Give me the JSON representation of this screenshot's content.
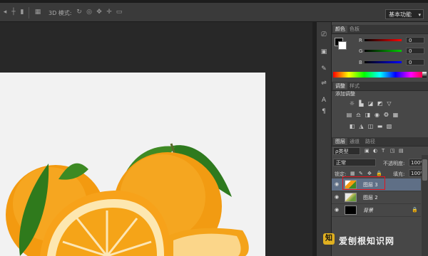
{
  "options_bar": {
    "mode_label": "3D 模式:",
    "workspace": "基本功能"
  },
  "color_panel": {
    "tabs": [
      "颜色",
      "色板"
    ],
    "channels": [
      {
        "label": "R",
        "value": "0",
        "color": "#d02020"
      },
      {
        "label": "G",
        "value": "0",
        "color": "#20a020"
      },
      {
        "label": "B",
        "value": "0",
        "color": "#2030d0"
      }
    ]
  },
  "adjust_panel": {
    "tabs": [
      "调整",
      "样式"
    ],
    "heading": "添加调整"
  },
  "layers_panel": {
    "tabs": [
      "图层",
      "通道",
      "路径"
    ],
    "kind": "ρ类型",
    "blend_mode": "正常",
    "opacity_label": "不透明度:",
    "opacity_value": "100%",
    "lock_label": "锁定:",
    "fill_label": "填充:",
    "fill_value": "100%",
    "layers": [
      {
        "name": "图层 3",
        "selected": true
      },
      {
        "name": "图层 2",
        "selected": false
      },
      {
        "name": "背景",
        "selected": false
      }
    ]
  },
  "watermark": {
    "text": "爱刨根知识网"
  },
  "icons": [
    "move-icon",
    "align-icon",
    "3d-rotate-icon",
    "3d-roll-icon",
    "3d-pan-icon",
    "3d-slide-icon",
    "3d-scale-icon",
    "eye-icon",
    "lock-icon",
    "brush-icon",
    "character-icon",
    "paragraph-icon"
  ]
}
